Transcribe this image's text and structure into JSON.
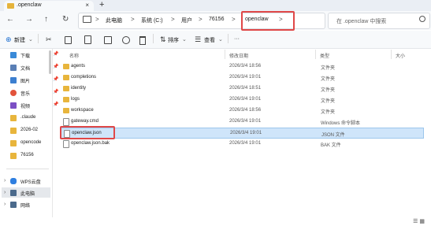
{
  "tab": {
    "title": ".openclaw",
    "close": "×",
    "new": "+"
  },
  "nav": {
    "back": "←",
    "forward": "→",
    "up": "↑",
    "refresh": "↻"
  },
  "address": {
    "crumbs": [
      "此电脑",
      "系统 (C:)",
      "用户",
      "76156",
      "openclaw"
    ],
    "separator": ">"
  },
  "search": {
    "placeholder": "在 .openclaw 中搜索"
  },
  "toolbar": {
    "new_label": "新建",
    "sort_label": "排序",
    "view_label": "查看",
    "more_label": "···"
  },
  "sidebar": {
    "quick": [
      {
        "label": "下载",
        "color": "#3a8ad8"
      },
      {
        "label": "文档",
        "color": "#5a7fb5"
      },
      {
        "label": "图片",
        "color": "#3c7fd0"
      },
      {
        "label": "音乐",
        "color": "#e2533b"
      },
      {
        "label": "视频",
        "color": "#7b4fc4"
      },
      {
        "label": ".claude",
        "color": "#e8b53c"
      },
      {
        "label": "2026-02",
        "color": "#e8b53c"
      },
      {
        "label": "opencode",
        "color": "#e8b53c"
      },
      {
        "label": "76156",
        "color": "#e8b53c"
      }
    ],
    "groups": [
      {
        "label": "WPS云盘",
        "color": "#2f7fe0"
      },
      {
        "label": "此电脑",
        "color": "#4b6a8c"
      },
      {
        "label": "网络",
        "color": "#4b6a8c"
      }
    ]
  },
  "columns": {
    "name": "名称",
    "date": "修改日期",
    "type": "类型",
    "size": "大小"
  },
  "files": [
    {
      "name": "agents",
      "date": "2026/3/4 18:56",
      "type": "文件夹",
      "kind": "folder"
    },
    {
      "name": "completions",
      "date": "2026/3/4 19:01",
      "type": "文件夹",
      "kind": "folder"
    },
    {
      "name": "identity",
      "date": "2026/3/4 18:51",
      "type": "文件夹",
      "kind": "folder"
    },
    {
      "name": "logs",
      "date": "2026/3/4 19:01",
      "type": "文件夹",
      "kind": "folder"
    },
    {
      "name": "workspace",
      "date": "2026/3/4 18:56",
      "type": "文件夹",
      "kind": "folder"
    },
    {
      "name": "gateway.cmd",
      "date": "2026/3/4 19:01",
      "type": "Windows 命令脚本",
      "kind": "doc"
    },
    {
      "name": "openclaw.json",
      "date": "2026/3/4 19:01",
      "type": "JSON 文件",
      "kind": "doc"
    },
    {
      "name": "openclaw.json.bak",
      "date": "2026/3/4 19:01",
      "type": "BAK 文件",
      "kind": "doc"
    }
  ],
  "selected_file": "openclaw.json"
}
